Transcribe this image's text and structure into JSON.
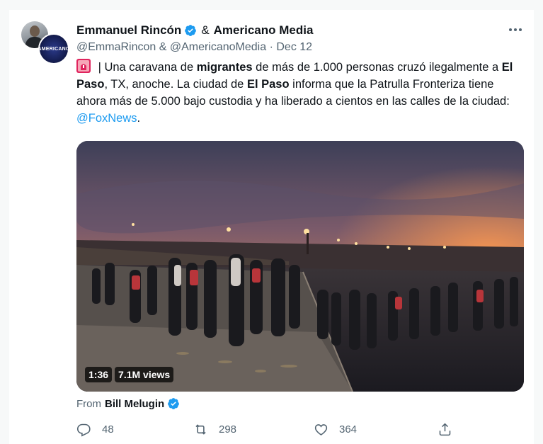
{
  "tweet": {
    "authors": {
      "primary_name": "Emmanuel Rincón",
      "conjunction": "&",
      "secondary_name": "Americano Media",
      "handles": "@EmmaRincon & @AmericanoMedia",
      "separator": "·",
      "date": "Dec 12",
      "avatar_b_text": "AMERICANO"
    },
    "more_icon": "more-horizontal-icon",
    "text": {
      "part1": " | Una caravana de ",
      "bold1": "migrantes",
      "part2": " de más de 1.000 personas cruzó ilegalmente a ",
      "bold2": "El Paso",
      "part3": ", TX, anoche. La ciudad de ",
      "bold3": "El Paso",
      "part4": " informa que la Patrulla Fronteriza tiene ahora más de 5.000 bajo custodia y ha liberado a cientos en las calles de la ciudad: ",
      "link": "@FoxNews",
      "part5": "."
    },
    "media": {
      "duration": "1:36",
      "views": "7.1M views"
    },
    "from": {
      "label": "From",
      "name": "Bill Melugin"
    },
    "actions": {
      "replies": "48",
      "retweets": "298",
      "likes": "364"
    },
    "colors": {
      "link": "#1d9bf0",
      "verified": "#1d9bf0",
      "secondary_text": "#536471",
      "siren": "#e0245e"
    }
  }
}
